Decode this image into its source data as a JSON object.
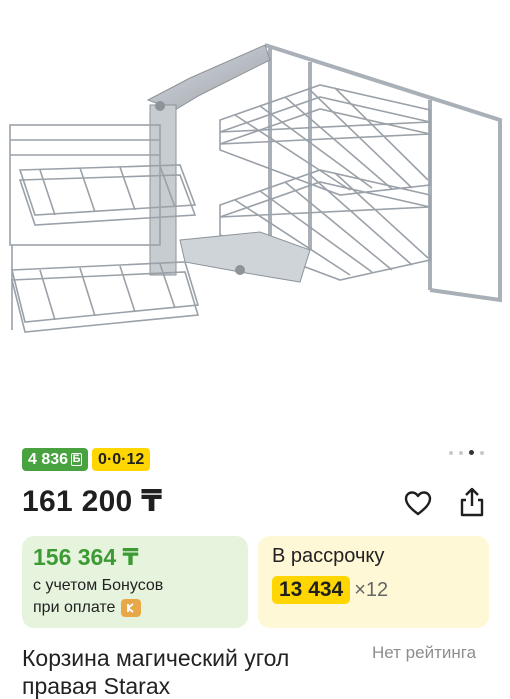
{
  "product": {
    "image_alt": "Corner magic basket with chrome wire shelves",
    "price": "161 200 ₸",
    "title": "Корзина магический угол правая Starax",
    "rating_text": "Нет рейтинга"
  },
  "badges": {
    "bonus_value": "4 836",
    "bonus_icon": "Б",
    "installment": "0·0·12"
  },
  "gallery": {
    "dots_count": 4,
    "active_index": 2
  },
  "bonus_card": {
    "price": "156 364 ₸",
    "line1": "с учетом Бонусов",
    "line2": "при оплате",
    "pay_icon": "kaspi-pay-icon"
  },
  "installment_card": {
    "title": "В рассрочку",
    "monthly": "13 434",
    "months": "×12"
  },
  "icons": {
    "favorite": "heart-icon",
    "share": "share-icon"
  },
  "colors": {
    "bonus_green": "#48a23f",
    "installment_yellow": "#ffd600",
    "bonus_card_bg": "#e6f4de",
    "installment_card_bg": "#fff8d6"
  }
}
